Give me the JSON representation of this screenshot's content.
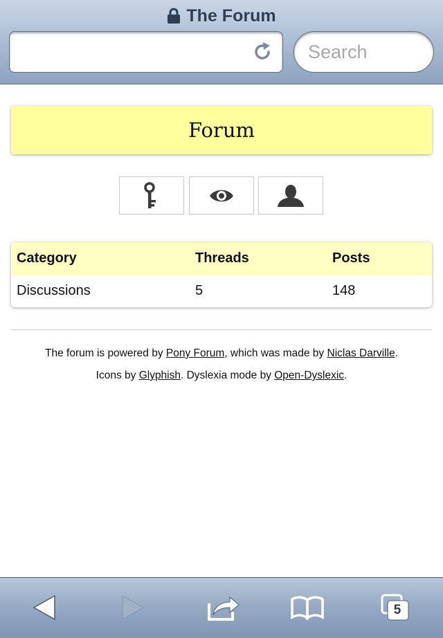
{
  "browser": {
    "title": "The Forum",
    "url_value": "",
    "search_placeholder": "Search",
    "tab_count": "5"
  },
  "forum": {
    "heading": "Forum",
    "icon_buttons": [
      "key-icon",
      "eye-icon",
      "user-icon"
    ]
  },
  "table": {
    "headers": [
      "Category",
      "Threads",
      "Posts"
    ],
    "rows": [
      [
        "Discussions",
        "5",
        "148"
      ]
    ]
  },
  "footer": {
    "line1_prefix": "The forum is powered by ",
    "line1_link1": "Pony Forum",
    "line1_middle": ", which was made by ",
    "line1_link2": "Niclas Darville",
    "line1_suffix": ".",
    "line2_prefix": "Icons by ",
    "line2_link1": "Glyphish",
    "line2_middle": ". Dyslexia mode by ",
    "line2_link2": "Open-Dyslexic",
    "line2_suffix": "."
  },
  "toolbar": {
    "icons": [
      "back-icon",
      "forward-icon",
      "share-icon",
      "bookmarks-icon",
      "tabs-icon"
    ]
  },
  "colors": {
    "header_yellow": "#ffff9e",
    "table_head_yellow": "#ffffc3",
    "chrome_blue": "#8ea3bd"
  }
}
